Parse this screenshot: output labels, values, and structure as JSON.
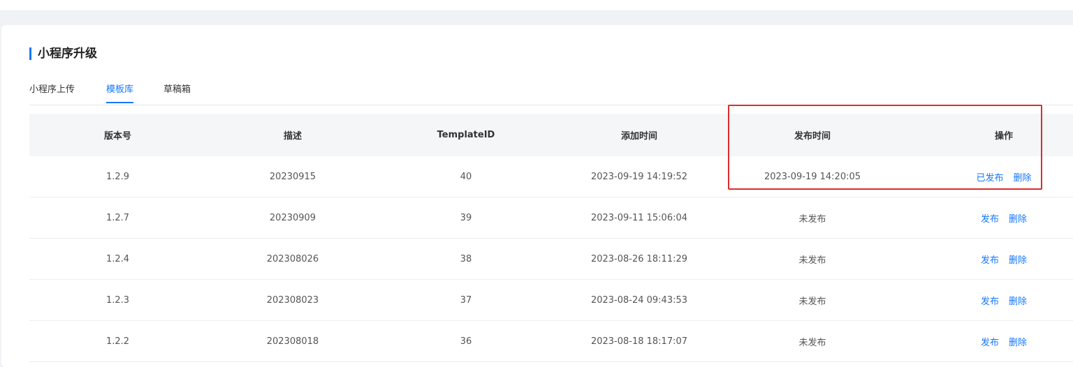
{
  "page": {
    "title": "小程序升级"
  },
  "tabs": [
    {
      "label": "小程序上传"
    },
    {
      "label": "模板库"
    },
    {
      "label": "草稿箱"
    }
  ],
  "table": {
    "headers": [
      "版本号",
      "描述",
      "TemplateID",
      "添加时间",
      "发布时间",
      "操作"
    ],
    "rows": [
      {
        "version": "1.2.9",
        "desc": "20230915",
        "template_id": "40",
        "added": "2023-09-19 14:19:52",
        "published": "2023-09-19 14:20:05",
        "action1": "已发布",
        "action2": "删除"
      },
      {
        "version": "1.2.7",
        "desc": "20230909",
        "template_id": "39",
        "added": "2023-09-11 15:06:04",
        "published": "未发布",
        "action1": "发布",
        "action2": "删除"
      },
      {
        "version": "1.2.4",
        "desc": "202308026",
        "template_id": "38",
        "added": "2023-08-26 18:11:29",
        "published": "未发布",
        "action1": "发布",
        "action2": "删除"
      },
      {
        "version": "1.2.3",
        "desc": "202308023",
        "template_id": "37",
        "added": "2023-08-24 09:43:53",
        "published": "未发布",
        "action1": "发布",
        "action2": "删除"
      },
      {
        "version": "1.2.2",
        "desc": "202308018",
        "template_id": "36",
        "added": "2023-08-18 18:17:07",
        "published": "未发布",
        "action1": "发布",
        "action2": "删除"
      }
    ]
  },
  "colors": {
    "accent": "#1677ff",
    "highlight": "#e02b2b"
  }
}
